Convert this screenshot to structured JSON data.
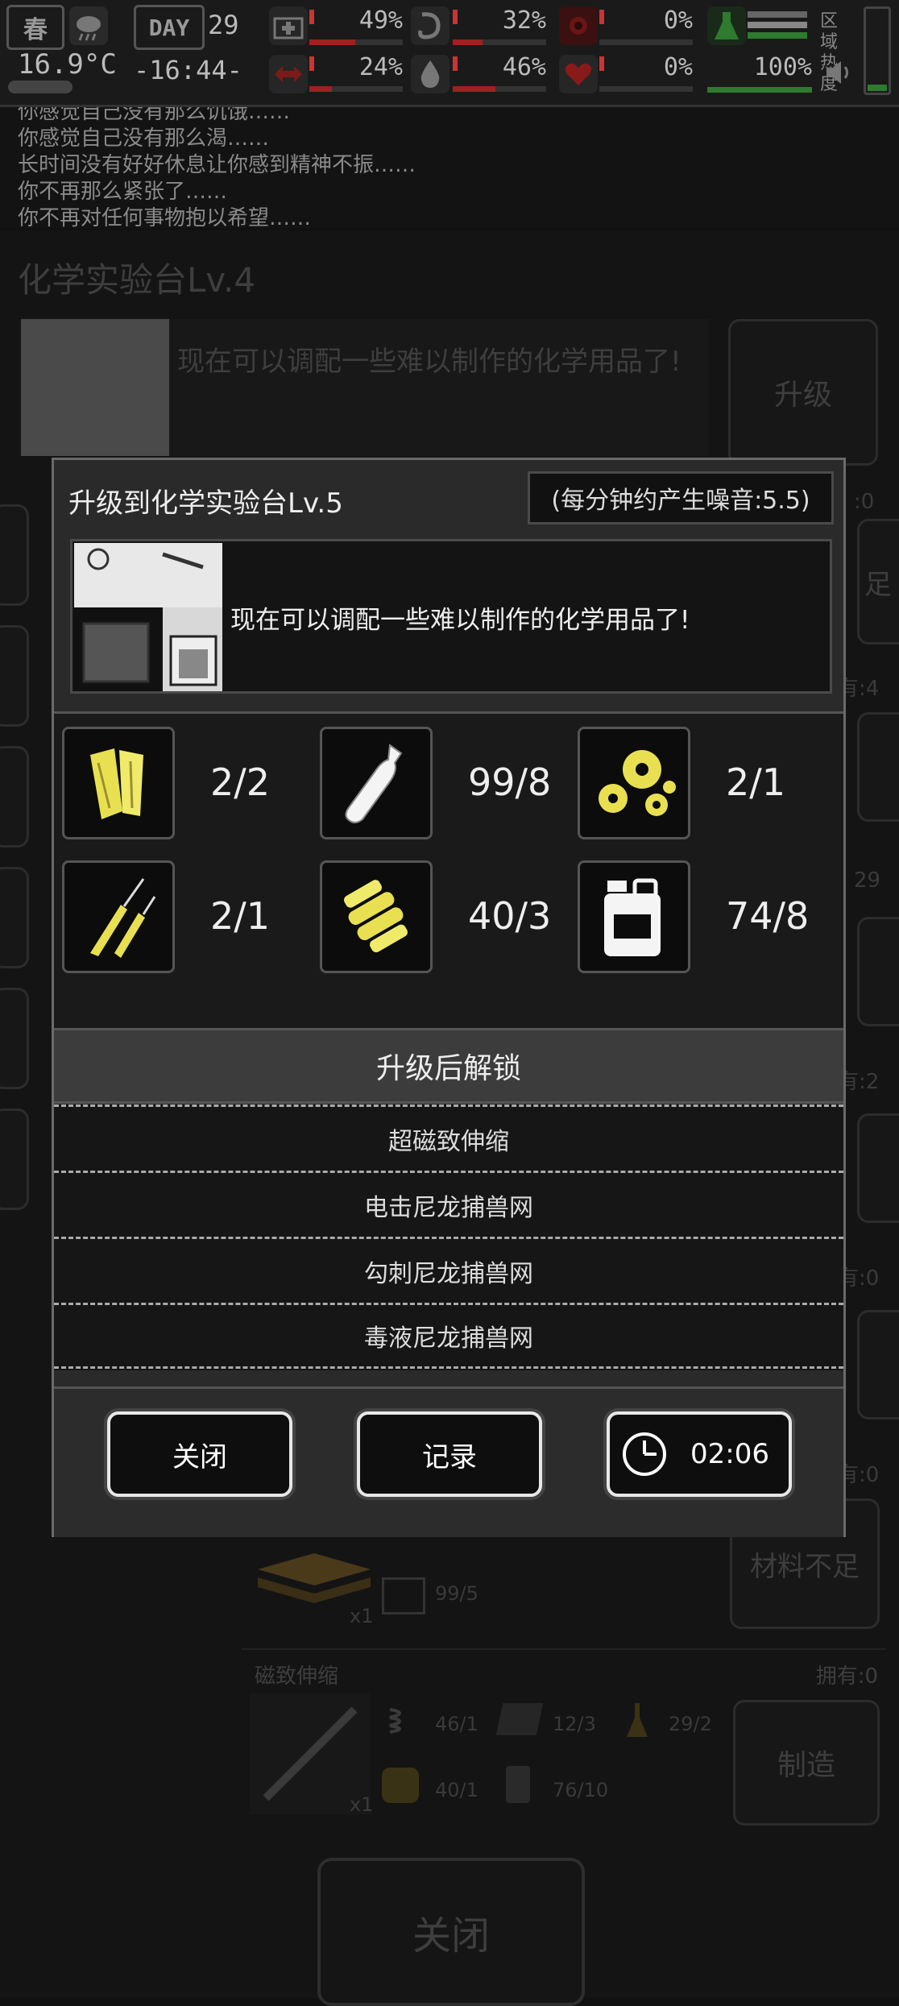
{
  "status": {
    "season": "春",
    "day_label": "DAY",
    "day": "29",
    "temperature": "16.9°C",
    "time": "-16:44-",
    "meters": [
      {
        "name": "health",
        "value": "49%",
        "color": "#b02020"
      },
      {
        "name": "hunger",
        "value": "32%",
        "color": "#b02020"
      },
      {
        "name": "infection",
        "value": "0%",
        "color": "#b02020"
      },
      {
        "name": "fatigue",
        "value": "24%",
        "color": "#b02020"
      },
      {
        "name": "thirst",
        "value": "46%",
        "color": "#b02020"
      },
      {
        "name": "heart",
        "value": "0%",
        "color": "#b02020"
      }
    ],
    "progress": "100%",
    "area_heat_label": "区域热度"
  },
  "log": [
    "你感觉自己没有那么饥饿……",
    "你感觉自己没有那么渴……",
    "长时间没有好好休息让你感到精神不振……",
    "你不再那么紧张了……",
    "你不再对任何事物抱以希望……"
  ],
  "background": {
    "station_title": "化学实验台Lv.4",
    "station_desc": "现在可以调配一些难以制作的化学用品了!",
    "upgrade_label": "升级",
    "right_labels": [
      "足",
      "有:4",
      "29",
      "有:2",
      "有:0",
      "有:0"
    ],
    "item1": {
      "count": "x1",
      "mat": "99/5",
      "button": "材料不足"
    },
    "item2": {
      "name": "磁致伸缩",
      "owned": "拥有:0",
      "count": "x1",
      "mats": [
        "46/1",
        "12/3",
        "29/2",
        "40/1",
        "76/10"
      ],
      "button": "制造"
    },
    "close_label": "关闭"
  },
  "modal": {
    "title": "升级到化学实验台Lv.5",
    "noise": "(每分钟约产生噪音:5.5)",
    "description": "现在可以调配一些难以制作的化学用品了!",
    "materials": [
      {
        "icon": "wood-icon",
        "count": "2/2"
      },
      {
        "icon": "bottle-icon",
        "count": "99/8"
      },
      {
        "icon": "gears-icon",
        "count": "2/1"
      },
      {
        "icon": "wire-icon",
        "count": "2/1"
      },
      {
        "icon": "spring-icon",
        "count": "40/3"
      },
      {
        "icon": "jerrycan-icon",
        "count": "74/8"
      }
    ],
    "unlock_header": "升级后解锁",
    "unlocks": [
      "超磁致伸缩",
      "电击尼龙捕兽网",
      "勾刺尼龙捕兽网",
      "毒液尼龙捕兽网"
    ],
    "close_button": "关闭",
    "log_button": "记录",
    "timer": "02:06"
  }
}
